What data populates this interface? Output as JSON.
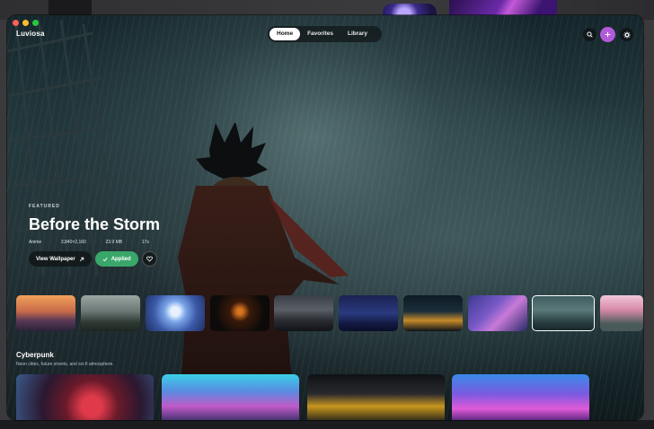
{
  "app": {
    "name": "Luviosa"
  },
  "nav": {
    "tabs": [
      {
        "label": "Home",
        "active": true
      },
      {
        "label": "Favorites",
        "active": false
      },
      {
        "label": "Library",
        "active": false
      }
    ]
  },
  "toolbar": {
    "search_icon": "search-icon",
    "add_icon": "plus-icon",
    "settings_icon": "gear-icon",
    "accent": "#b25bd9"
  },
  "featured": {
    "label": "FEATURED",
    "title": "Before the Storm",
    "meta": {
      "category": "Anime",
      "resolution": "3,840×2,160",
      "size": "23.9 MB",
      "duration": "17s"
    },
    "view_label": "View Wallpaper",
    "view_icon": "external-arrow-icon",
    "applied_label": "Applied",
    "applied_icon": "check-icon",
    "applied_color": "#3aa76a",
    "favorite_icon": "heart-icon"
  },
  "thumbnails": [
    {
      "theme": "mountain-sunset",
      "selected": false
    },
    {
      "theme": "misty-forest-lake",
      "selected": false
    },
    {
      "theme": "crystal-tower",
      "selected": false
    },
    {
      "theme": "dark-glowing-eyes",
      "selected": false
    },
    {
      "theme": "night-street-car",
      "selected": false
    },
    {
      "theme": "starry-night",
      "selected": false
    },
    {
      "theme": "city-night-lights",
      "selected": false
    },
    {
      "theme": "purple-anime-sky",
      "selected": false
    },
    {
      "theme": "before-the-storm",
      "selected": true
    },
    {
      "theme": "pink-blossom",
      "selected": false
    }
  ],
  "section": {
    "title": "Cyberpunk",
    "subtitle": "Neon cities, future streets, and sci-fi atmosphere.",
    "cards": [
      {
        "theme": "neon-red-portal"
      },
      {
        "theme": "blue-pink-skyline"
      },
      {
        "theme": "night-alley-neon"
      },
      {
        "theme": "purple-neon-hall"
      }
    ]
  }
}
